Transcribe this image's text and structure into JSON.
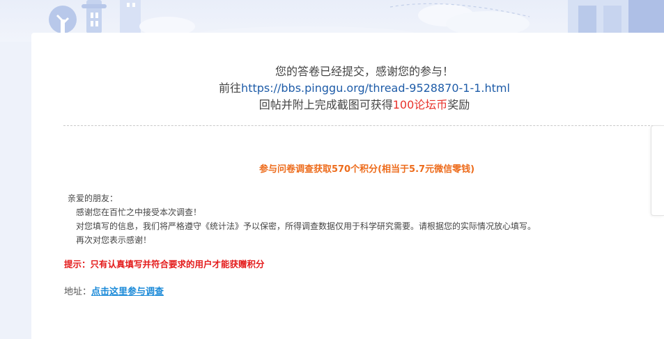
{
  "header": {
    "background_color": "#e9eef9",
    "illustration": "city-skyline-illustration"
  },
  "notice": {
    "line1": "您的答卷已经提交，感谢您的参与！",
    "line2_prefix": "前往",
    "line2_link": "https://bbs.pinggu.org/thread-9528870-1-1.html",
    "line3_prefix": "回帖并附上完成截图可获得",
    "line3_highlight": "100论坛币",
    "line3_suffix": "奖励"
  },
  "promo": {
    "text": "参与问卷调查获取570个积分(相当于5.7元微信零钱)"
  },
  "letter": {
    "greeting": "亲爱的朋友：",
    "lines": [
      "感谢您在百忙之中接受本次调查！",
      "对您填写的信息，我们将严格遵守《统计法》予以保密，所得调查数据仅用于科学研究需要。请根据您的实际情况放心填写。",
      "再次对您表示感谢！"
    ]
  },
  "tip": {
    "text": "提示：只有认真填写并符合要求的用户才能获赠积分"
  },
  "address": {
    "label": "地址：",
    "link_text": "点击这里参与调查"
  },
  "colors": {
    "link_blue": "#1e5ca8",
    "coin_red": "#e8322b",
    "promo_orange": "#ed6b1b",
    "tip_red": "#e41b1b",
    "address_link": "#1b8ad8"
  }
}
